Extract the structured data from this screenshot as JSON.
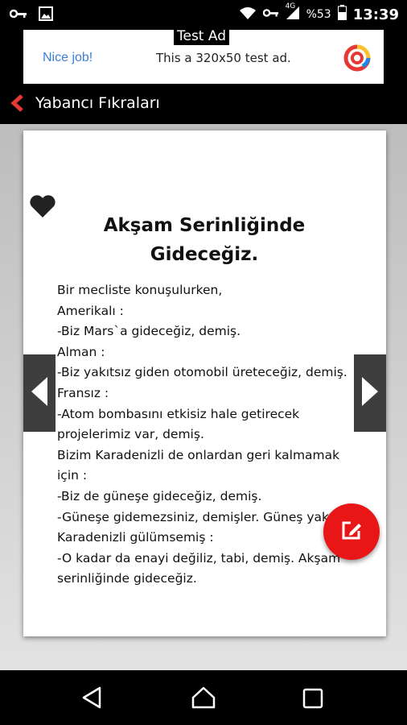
{
  "status_bar": {
    "network": "4G",
    "battery_percent": "%53",
    "time": "13:39",
    "icons": [
      "key-icon",
      "image-icon",
      "wifi-icon",
      "key-icon",
      "signal-icon",
      "battery-icon"
    ]
  },
  "ad": {
    "label": "Test Ad",
    "left_text": "Nice job!",
    "text": "This a 320x50 test ad.",
    "logo": "ad-logo-icon"
  },
  "app_bar": {
    "title": "Yabancı Fıkraları",
    "back_icon": "chevron-left-icon"
  },
  "joke": {
    "title": "Akşam Serinliğinde Gideceğiz.",
    "body": "Bir mecliste konuşulurken,\nAmerikalı :\n-Biz Mars`a gideceğiz, demiş.\nAlman :\n-Biz yakıtsız giden otomobil üreteceğiz, demiş.\nFransız :\n-Atom bombasını etkisiz hale getirecek projelerimiz var, demiş.\nBizim Karadenizli de onlardan geri kalmamak için :\n-Biz de güneşe gideceğiz, demiş.\n-Güneşe gidemezsiniz, demişler. Güneş yakar.\nKaradenizli gülümsemiş :\n-O kadar da enayi değiliz, tabi, demiş. Akşam serinliğinde gideceğiz."
  },
  "colors": {
    "accent": "#e81616",
    "back_arrow": "#e53935",
    "background_top": "#bdbdbd",
    "background_bottom": "#e2e2e2",
    "nav_arrow_bg": "#3e3e3e"
  }
}
